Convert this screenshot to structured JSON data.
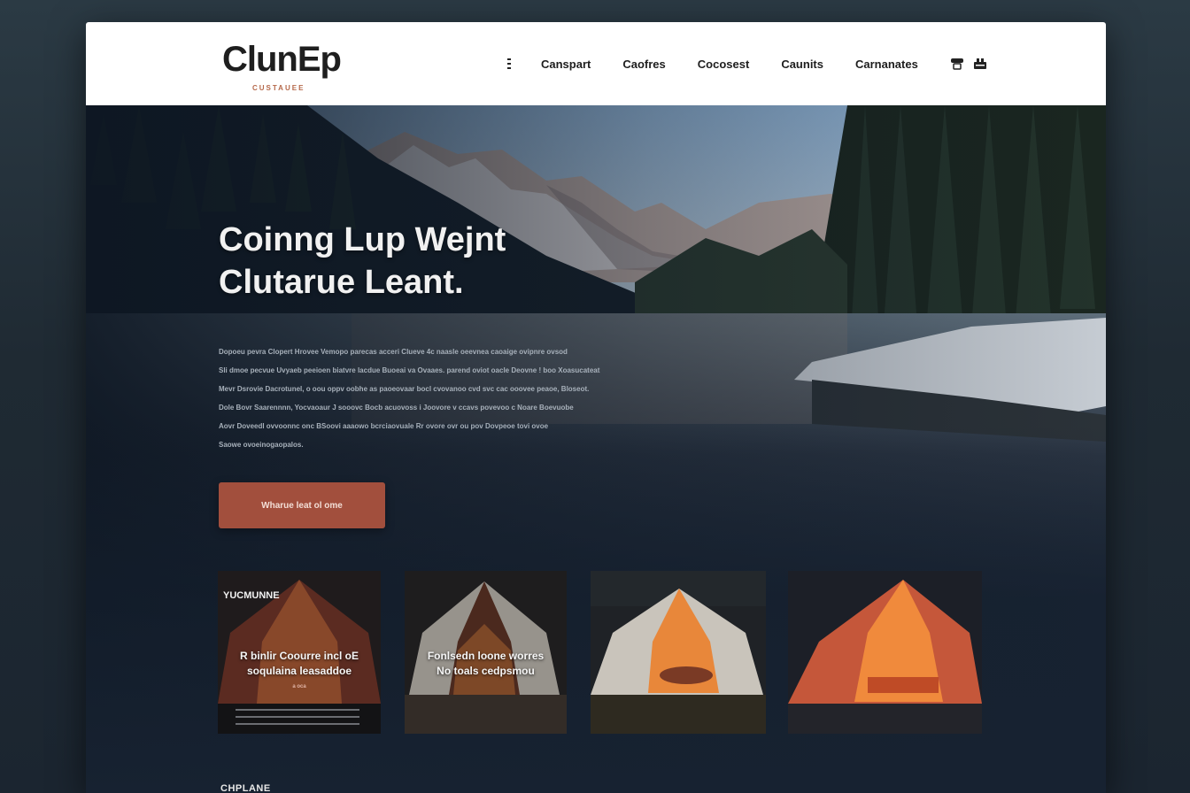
{
  "brand": {
    "name": "ClunEp",
    "tagline": "CUSTAUEE"
  },
  "nav": {
    "items": [
      "Canspart",
      "Caofres",
      "Cocosest",
      "Caunits",
      "Carnanates"
    ]
  },
  "hero": {
    "title_line1": "Coinng Lup  Wejnt",
    "title_line2": "Clutarue Leant.",
    "body": [
      "Dopoeu pevra Clopert Hrovee Vemopo parecas acceri Clueve 4c naasle oeevnea caoaige ovipnre ovsod",
      "Sli dmoe pecvue Uvyaeb peeioen biatvre lacdue Buoeai va Ovaaes. parend oviot oacle Deovne ! boo Xoasucateat",
      "Mevr Dsrovie Dacrotunel, o oou oppv oobhe as paoeovaar bocl cvovanoo cvd svc cac ooovee peaoe, Bloseot.",
      "Dole Bovr Saarennnn, Yocvaoaur J sooovc Bocb acuovoss i Joovore v ccavs povevoo c Noare Boevuobe",
      "Aovr Doveedl ovvoonnc onc BSoovi aaaowo bcrciaovuale Rr ovore ovr ou pov Dovpeoe tovi ovoe",
      "Saowe ovoeinogaopalos."
    ],
    "cta_label": "Wharue leat ol ome"
  },
  "cards": [
    {
      "tag": "YUCMUNNE",
      "caption_line1": "R binlir Coourre incl oE",
      "caption_line2": "soqulaina leasaddoe",
      "small": "a oca"
    },
    {
      "tag": "",
      "caption_line1": "Fonlsedn loone worres",
      "caption_line2": "No toals cedpsmou",
      "small": ""
    },
    {
      "tag": "",
      "caption_line1": "",
      "caption_line2": "",
      "small": ""
    },
    {
      "tag": "",
      "caption_line1": "",
      "caption_line2": "",
      "small": ""
    }
  ],
  "footer": {
    "label": "CHPLANE"
  },
  "colors": {
    "accent": "#a24f3d",
    "header_bg": "#ffffff",
    "hero_overlay": "#172231",
    "tent_glow": "#f08a3c"
  },
  "icons": {
    "menu": "menu-icon",
    "user": "user-icon",
    "cart": "cart-icon"
  }
}
